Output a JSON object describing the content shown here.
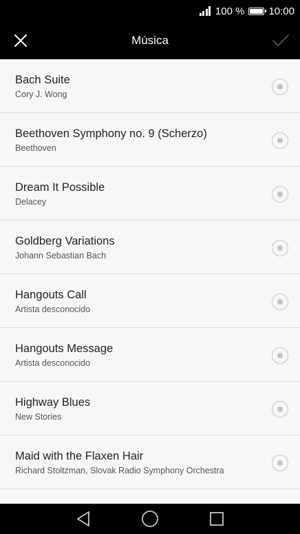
{
  "status_bar": {
    "battery_percent": "100 %",
    "time": "10:00"
  },
  "header": {
    "title": "Música",
    "close_icon": "close-icon",
    "confirm_icon": "check-icon"
  },
  "songs": [
    {
      "title": "Bach Suite",
      "artist": "Cory J. Wong"
    },
    {
      "title": "Beethoven Symphony no. 9 (Scherzo)",
      "artist": "Beethoven"
    },
    {
      "title": "Dream It Possible",
      "artist": "Delacey"
    },
    {
      "title": "Goldberg Variations",
      "artist": "Johann Sebastian Bach"
    },
    {
      "title": "Hangouts Call",
      "artist": "Artista desconocido"
    },
    {
      "title": "Hangouts Message",
      "artist": "Artista desconocido"
    },
    {
      "title": "Highway Blues",
      "artist": "New Stories"
    },
    {
      "title": "Maid with the Flaxen Hair",
      "artist": "Richard Stoltzman, Slovak Radio Symphony Orchestra"
    }
  ],
  "nav": {
    "back_icon": "back-triangle-icon",
    "home_icon": "home-circle-icon",
    "recents_icon": "recents-square-icon"
  },
  "colors": {
    "bar_background": "#000000",
    "list_background": "#f7f7f7",
    "divider": "#dcdcdc",
    "radio": "#c4c4c4"
  }
}
